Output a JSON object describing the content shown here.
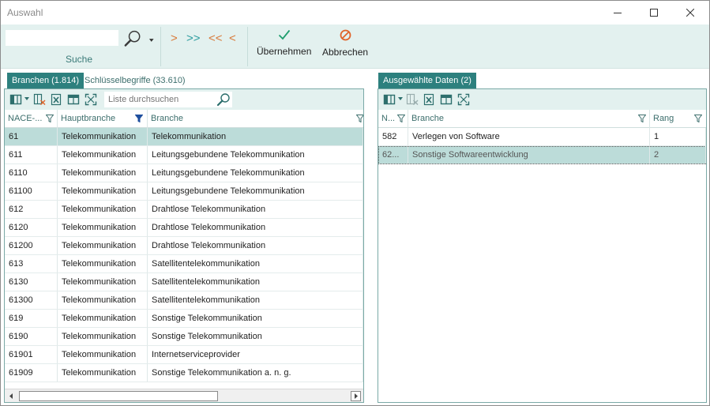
{
  "window": {
    "title": "Auswahl"
  },
  "ribbon": {
    "search_value": "",
    "search_group_label": "Suche",
    "nav_buttons": [
      ">",
      ">>",
      "<<",
      "<"
    ],
    "apply_label": "Übernehmen",
    "cancel_label": "Abbrechen"
  },
  "left_panel": {
    "tabs": [
      {
        "label": "Branchen (1.814)",
        "active": true
      },
      {
        "label": "Schlüsselbegriffe (33.610)",
        "active": false
      }
    ],
    "list_search_placeholder": "Liste durchsuchen",
    "columns": [
      "NACE-...",
      "Hauptbranche",
      "Branche"
    ],
    "rows": [
      [
        "61",
        "Telekommunikation",
        "Telekommunikation"
      ],
      [
        "611",
        "Telekommunikation",
        "Leitungsgebundene Telekommunikation"
      ],
      [
        "6110",
        "Telekommunikation",
        "Leitungsgebundene Telekommunikation"
      ],
      [
        "61100",
        "Telekommunikation",
        "Leitungsgebundene Telekommunikation"
      ],
      [
        "612",
        "Telekommunikation",
        "Drahtlose Telekommunikation"
      ],
      [
        "6120",
        "Telekommunikation",
        "Drahtlose Telekommunikation"
      ],
      [
        "61200",
        "Telekommunikation",
        "Drahtlose Telekommunikation"
      ],
      [
        "613",
        "Telekommunikation",
        "Satellitentelekommunikation"
      ],
      [
        "6130",
        "Telekommunikation",
        "Satellitentelekommunikation"
      ],
      [
        "61300",
        "Telekommunikation",
        "Satellitentelekommunikation"
      ],
      [
        "619",
        "Telekommunikation",
        "Sonstige Telekommunikation"
      ],
      [
        "6190",
        "Telekommunikation",
        "Sonstige Telekommunikation"
      ],
      [
        "61901",
        "Telekommunikation",
        "Internetserviceprovider"
      ],
      [
        "61909",
        "Telekommunikation",
        "Sonstige Telekommunikation a. n. g."
      ]
    ]
  },
  "right_panel": {
    "tab_label": "Ausgewählte Daten (2)",
    "columns": [
      "N...",
      "Branche",
      "Rang"
    ],
    "rows": [
      [
        "582",
        "Verlegen von Software",
        "1"
      ],
      [
        "62...",
        "Sonstige Softwareentwicklung",
        "2"
      ]
    ]
  },
  "colors": {
    "accent": "#2d807e",
    "ribbon_bg": "#e3f1ef",
    "selected_row": "#bcdcd9",
    "nav_orange": "#d87a3a",
    "apply_green": "#1f9e6e",
    "cancel_orange": "#e0642a"
  }
}
